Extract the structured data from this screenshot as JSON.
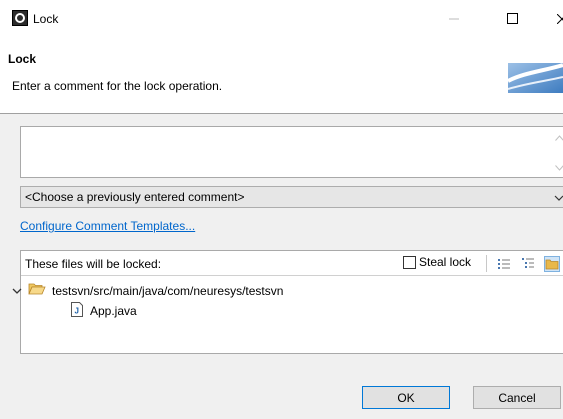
{
  "window": {
    "title": "Lock"
  },
  "header": {
    "title": "Lock",
    "description": "Enter a comment for the lock operation."
  },
  "comment": {
    "value": "",
    "history_selected": "<Choose a previously entered comment>"
  },
  "link": {
    "label": "Configure Comment Templates..."
  },
  "files": {
    "label": "These files will be locked:",
    "steal_lock_label": "Steal lock",
    "steal_lock_checked": false,
    "tree": [
      {
        "label": "testsvn/src/main/java/com/neuresys/testsvn",
        "icon": "folder-open-icon",
        "expanded": true
      },
      {
        "label": "App.java",
        "icon": "java-file-icon"
      }
    ]
  },
  "buttons": {
    "ok": "OK",
    "cancel": "Cancel"
  },
  "colors": {
    "link": "#0066cc",
    "folder": "#e8b84a",
    "banner": "#3e7cc0",
    "selected_toolbar": "#cfe4f7"
  },
  "icons": [
    "app-icon",
    "minimize-icon",
    "maximize-icon",
    "close-icon",
    "svn-banner-icon",
    "scroll-up-icon",
    "scroll-down-icon",
    "dropdown-arrow-icon",
    "flat-list-icon",
    "tree-icon",
    "folder-view-icon",
    "expand-chevron-icon",
    "folder-open-icon",
    "java-file-icon"
  ]
}
